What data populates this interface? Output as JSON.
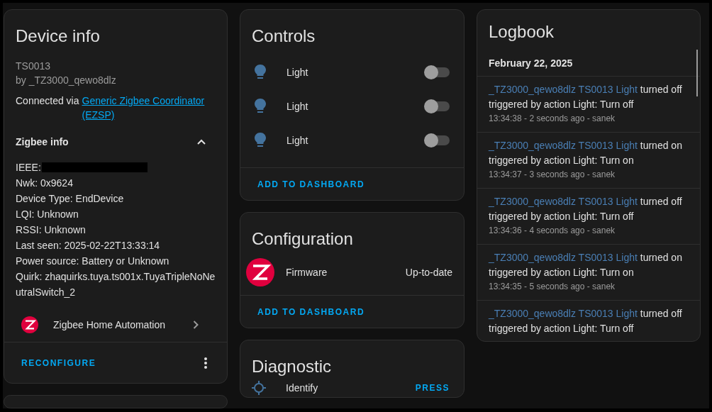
{
  "device_info": {
    "title": "Device info",
    "model": "TS0013",
    "manufacturer": "by _TZ3000_qewo8dlz",
    "connected_prefix": "Connected via",
    "connected_link": "Generic Zigbee Coordinator (EZSP)",
    "zigbee_info": {
      "title": "Zigbee info",
      "expanded": true,
      "ieee_label": "IEEE:",
      "ieee_redacted": true,
      "lines": [
        "Nwk: 0x9624",
        "Device Type: EndDevice",
        "LQI: Unknown",
        "RSSI: Unknown",
        "Last seen: 2025-02-22T13:33:14",
        "Power source: Battery or Unknown",
        "Quirk: zhaquirks.tuya.ts001x.TuyaTripleNoNeutralSwitch_2"
      ]
    },
    "integration": "Zigbee Home Automation",
    "action": "RECONFIGURE"
  },
  "controls": {
    "title": "Controls",
    "items": [
      {
        "label": "Light",
        "on": false
      },
      {
        "label": "Light",
        "on": false
      },
      {
        "label": "Light",
        "on": false
      }
    ],
    "action": "ADD TO DASHBOARD"
  },
  "configuration": {
    "title": "Configuration",
    "items": [
      {
        "label": "Firmware",
        "value": "Up-to-date"
      }
    ],
    "action": "ADD TO DASHBOARD"
  },
  "diagnostic": {
    "title": "Diagnostic",
    "items": [
      {
        "label": "Identify",
        "action": "PRESS"
      }
    ]
  },
  "logbook": {
    "title": "Logbook",
    "date": "February 22, 2025",
    "entries": [
      {
        "entity": "_TZ3000_qewo8dlz TS0013 Light",
        "message": "turned off",
        "trigger": "triggered by action Light: Turn off",
        "time": "13:34:38 - 2 seconds ago - sanek"
      },
      {
        "entity": "_TZ3000_qewo8dlz TS0013 Light",
        "message": "turned on",
        "trigger": "triggered by action Light: Turn on",
        "time": "13:34:37 - 3 seconds ago - sanek"
      },
      {
        "entity": "_TZ3000_qewo8dlz TS0013 Light",
        "message": "turned off",
        "trigger": "triggered by action Light: Turn off",
        "time": "13:34:36 - 4 seconds ago - sanek"
      },
      {
        "entity": "_TZ3000_qewo8dlz TS0013 Light",
        "message": "turned on",
        "trigger": "triggered by action Light: Turn on",
        "time": "13:34:35 - 5 seconds ago - sanek"
      },
      {
        "entity": "_TZ3000_qewo8dlz TS0013 Light",
        "message": "turned off",
        "trigger": "triggered by action Light: Turn off"
      }
    ]
  }
}
